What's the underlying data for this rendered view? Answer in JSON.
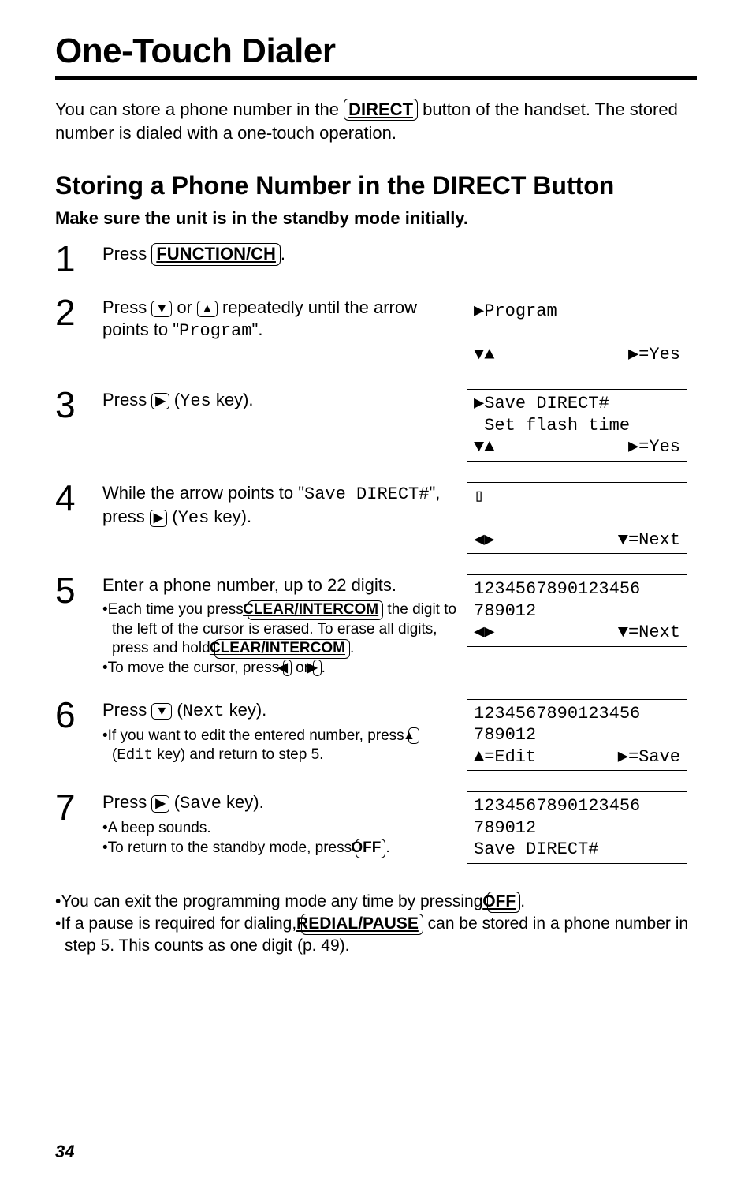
{
  "title": "One-Touch Dialer",
  "intro": {
    "part1": "You can store a phone number in the ",
    "key": "DIRECT",
    "part2": " button of the handset. The stored number is dialed with a one-touch operation."
  },
  "subheading": "Storing a Phone Number in the DIRECT Button",
  "boldline": "Make sure the unit is in the standby mode initially.",
  "keys": {
    "function": "FUNCTION/CH",
    "clear": "CLEAR/INTERCOM",
    "off": "OFF",
    "redial": "REDIAL/PAUSE",
    "down": "▼",
    "up": "▲",
    "right": "▶",
    "left": "◀"
  },
  "steps": {
    "s1": {
      "num": "1",
      "pressWord": "Press ",
      "key": "FUNCTION/CH",
      "after": "."
    },
    "s2": {
      "num": "2",
      "part1": "Press ",
      "part2": " or ",
      "part3": " repeatedly until the arrow points to \"",
      "mono": "Program",
      "part4": "\".",
      "lcd": {
        "l1": "▶Program",
        "l2l": "▼▲",
        "l2r": "▶=Yes"
      }
    },
    "s3": {
      "num": "3",
      "part1": "Press ",
      "part2": " (",
      "mono": "Yes",
      "part3": " key).",
      "lcd": {
        "l1": "▶Save DIRECT#",
        "l2": " Set flash time",
        "l3l": "▼▲",
        "l3r": "▶=Yes"
      }
    },
    "s4": {
      "num": "4",
      "part1": "While the arrow points to \"",
      "mono": "Save DIRECT#",
      "part2": "\", press ",
      "part3": " (",
      "monoYes": "Yes",
      "part4": " key).",
      "lcd": {
        "l1": "▯",
        "l2l": "◀▶",
        "l2r": "▼=Next"
      }
    },
    "s5": {
      "num": "5",
      "main": "Enter a phone number, up to 22 digits.",
      "b1a": "Each time you press ",
      "b1b": " the digit to the left of the cursor is erased. To erase all digits, press and hold ",
      "b1c": ".",
      "b2a": "To move the cursor, press ",
      "b2b": " or ",
      "b2c": ".",
      "lcd": {
        "l1": "1234567890123456",
        "l2": "789012",
        "l3l": "◀▶",
        "l3r": "▼=Next"
      }
    },
    "s6": {
      "num": "6",
      "part1": "Press ",
      "part2": " (",
      "mono": "Next",
      "part3": " key).",
      "b1a": "If you want to edit the entered number, press ",
      "b1b": " (",
      "monoEdit": "Edit",
      "b1c": " key) and return to step 5.",
      "lcd": {
        "l1": "1234567890123456",
        "l2": "789012",
        "l3l": "▲=Edit",
        "l3r": "▶=Save"
      }
    },
    "s7": {
      "num": "7",
      "part1": "Press ",
      "part2": " (",
      "mono": "Save",
      "part3": " key).",
      "b1": "A beep sounds.",
      "b2a": "To return to the standby mode, press ",
      "b2b": ".",
      "lcd": {
        "l1": "1234567890123456",
        "l2": "789012",
        "l3": "Save DIRECT#"
      }
    }
  },
  "footnotes": {
    "f1a": "You can exit the programming mode any time by pressing ",
    "f1b": ".",
    "f2a": "If a pause is required for dialing, ",
    "f2b": " can be stored in a phone number in step 5. This counts as one digit (p. 49)."
  },
  "pageNumber": "34"
}
